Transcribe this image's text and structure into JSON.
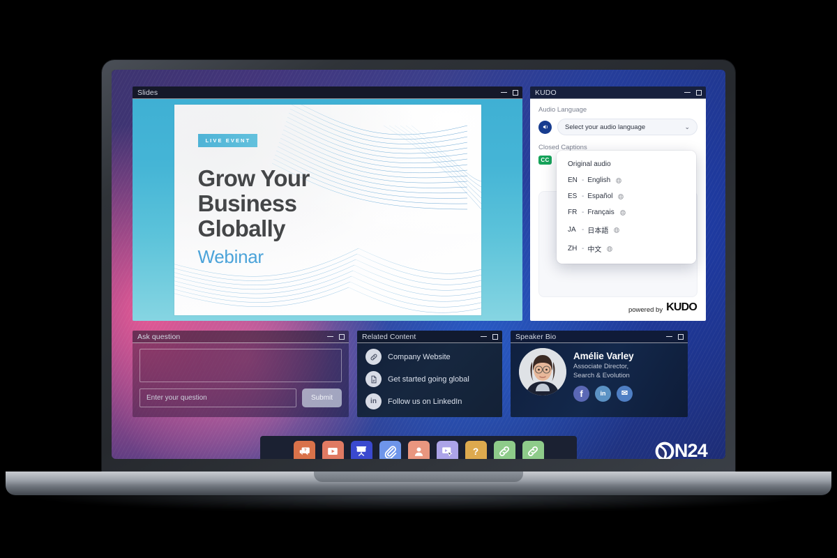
{
  "slides_panel": {
    "title": "Slides",
    "window_controls": {
      "minimize": "minimize-icon",
      "maximize": "maximize-icon"
    },
    "slide": {
      "badge": "LIVE EVENT",
      "title_line1": "Grow Your",
      "title_line2": "Business",
      "title_line3": "Globally",
      "subtitle": "Webinar",
      "accent_color": "#4ba3d9",
      "frame_color": "#45b5d6"
    }
  },
  "kudo_panel": {
    "title": "KUDO",
    "audio_language_label": "Audio Language",
    "audio_select_value": "Select your audio language",
    "speaker_icon": "speaker-icon",
    "chevron": "chevron-down-icon",
    "closed_captions_label": "Closed Captions",
    "cc_badge": "CC",
    "cc_badge_color": "#16a35a",
    "powered_by": "powered by",
    "brand": "KUDO",
    "dropdown": {
      "open": true,
      "options": [
        {
          "code": "",
          "dash": "",
          "name": "Original audio",
          "globe": false
        },
        {
          "code": "EN",
          "dash": "-",
          "name": "English",
          "globe": true
        },
        {
          "code": "ES",
          "dash": "-",
          "name": "Español",
          "globe": true
        },
        {
          "code": "FR",
          "dash": "-",
          "name": "Français",
          "globe": true
        },
        {
          "code": "JA",
          "dash": "-",
          "name": "日本語",
          "globe": true
        },
        {
          "code": "ZH",
          "dash": "-",
          "name": "中文",
          "globe": true
        }
      ]
    }
  },
  "ask_panel": {
    "title": "Ask question",
    "input_placeholder": "Enter your question",
    "submit_label": "Submit"
  },
  "related_panel": {
    "title": "Related Content",
    "items": [
      {
        "icon": "link-icon",
        "label": "Company Website"
      },
      {
        "icon": "document-icon",
        "label": "Get started going global"
      },
      {
        "icon": "linkedin-icon",
        "label": "Follow us on LinkedIn"
      }
    ]
  },
  "bio_panel": {
    "title": "Speaker Bio",
    "avatar": "speaker-avatar",
    "name": "Amélie Varley",
    "role_line1": "Associate Director,",
    "role_line2": "Search & Evolution",
    "socials": [
      {
        "icon": "facebook-icon",
        "glyph": "f",
        "color": "#5a68b5"
      },
      {
        "icon": "linkedin-icon",
        "glyph": "in",
        "color": "#5b92c4"
      },
      {
        "icon": "email-icon",
        "glyph": "✉",
        "color": "#4f7fc4"
      }
    ]
  },
  "toolbar": {
    "buttons": [
      {
        "name": "ask-question-tool",
        "icon": "question-bubble-icon",
        "color": "#d9724a"
      },
      {
        "name": "media-player-tool",
        "icon": "video-play-icon",
        "color": "#e07a63"
      },
      {
        "name": "slides-tool",
        "icon": "presentation-icon",
        "color": "#3a49cf"
      },
      {
        "name": "resources-tool",
        "icon": "paperclip-icon",
        "color": "#6e95ea"
      },
      {
        "name": "speaker-bio-tool",
        "icon": "person-icon",
        "color": "#e9967f"
      },
      {
        "name": "screen-share-tool",
        "icon": "screen-cursor-icon",
        "color": "#aca4e8"
      },
      {
        "name": "help-tool",
        "icon": "question-mark-icon",
        "color": "#dda94e"
      },
      {
        "name": "link-tool-1",
        "icon": "link-icon",
        "color": "#8ecb8a"
      },
      {
        "name": "link-tool-2",
        "icon": "link-icon",
        "color": "#8ecb8a"
      }
    ]
  },
  "branding": {
    "logo_text": "N24",
    "logo_mark": "on24-crescent-icon"
  }
}
